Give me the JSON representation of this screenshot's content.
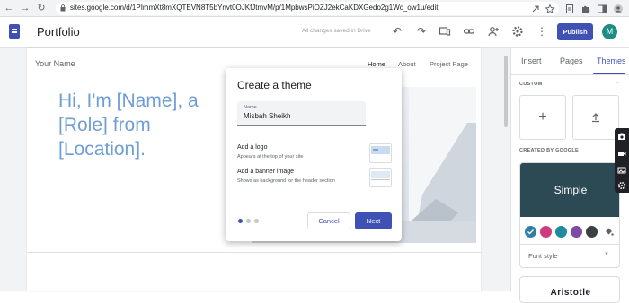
{
  "browser": {
    "url": "sites.google.com/d/1PImmXt8mXQTEVN8T5bYnvt0OJKfJtmvM/p/1MpbwsPiOZJ2ekCaKDXGedo2g1Wc_ow1u/edit"
  },
  "app": {
    "title": "Portfolio",
    "save_status": "All changes saved in Drive",
    "publish_label": "Publish",
    "avatar_letter": "M",
    "accent_color": "#3f51b5"
  },
  "page": {
    "site_name": "Your Name",
    "nav": [
      "Home",
      "About",
      "Project Page"
    ],
    "hero_text": "Hi, I'm [Name], a [Role] from [Location]."
  },
  "modal": {
    "title": "Create a theme",
    "name_label": "Name",
    "name_value": "Misbah Sheikh",
    "logo_title": "Add a logo",
    "logo_sub": "Appears at the top of your site",
    "banner_title": "Add a banner image",
    "banner_sub": "Shows as background for the header section",
    "cancel_label": "Cancel",
    "next_label": "Next"
  },
  "panel": {
    "tabs": [
      "Insert",
      "Pages",
      "Themes"
    ],
    "active_tab": "Themes",
    "custom_header": "CUSTOM",
    "created_header": "CREATED BY GOOGLE",
    "theme_name": "Simple",
    "font_style_label": "Font style",
    "next_theme_name": "Aristotle",
    "swatches": [
      "#2e7fa3",
      "#d03a7f",
      "#1f8aa0",
      "#7d4aa6",
      "#3c4043"
    ]
  }
}
